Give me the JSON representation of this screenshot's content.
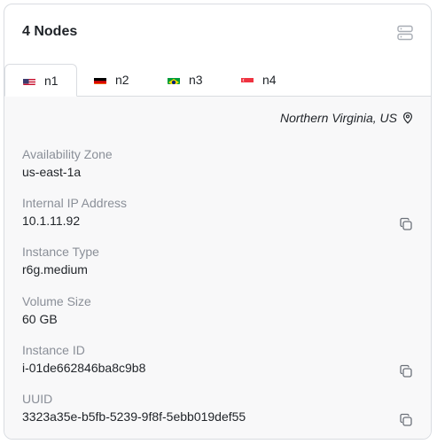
{
  "header": {
    "title": "4 Nodes",
    "icon": "server-icon"
  },
  "tabs": [
    {
      "label": "n1",
      "flag": "us-flag-icon",
      "active": true
    },
    {
      "label": "n2",
      "flag": "de-flag-icon",
      "active": false
    },
    {
      "label": "n3",
      "flag": "br-flag-icon",
      "active": false
    },
    {
      "label": "n4",
      "flag": "sg-flag-icon",
      "active": false
    }
  ],
  "region": {
    "label": "Northern Virginia, US",
    "icon": "location-pin-icon"
  },
  "fields": [
    {
      "label": "Availability Zone",
      "value": "us-east-1a",
      "copyable": false
    },
    {
      "label": "Internal IP Address",
      "value": "10.1.11.92",
      "copyable": true
    },
    {
      "label": "Instance Type",
      "value": "r6g.medium",
      "copyable": false
    },
    {
      "label": "Volume Size",
      "value": "60 GB",
      "copyable": false
    },
    {
      "label": "Instance ID",
      "value": "i-01de662846ba8c9b8",
      "copyable": true
    },
    {
      "label": "UUID",
      "value": "3323a35e-b5fb-5239-9f8f-5ebb019def55",
      "copyable": true
    }
  ],
  "colors": {
    "border": "#d9dce1",
    "label": "#8a8f98",
    "text": "#1f2328",
    "panel": "#f8f8f9"
  }
}
